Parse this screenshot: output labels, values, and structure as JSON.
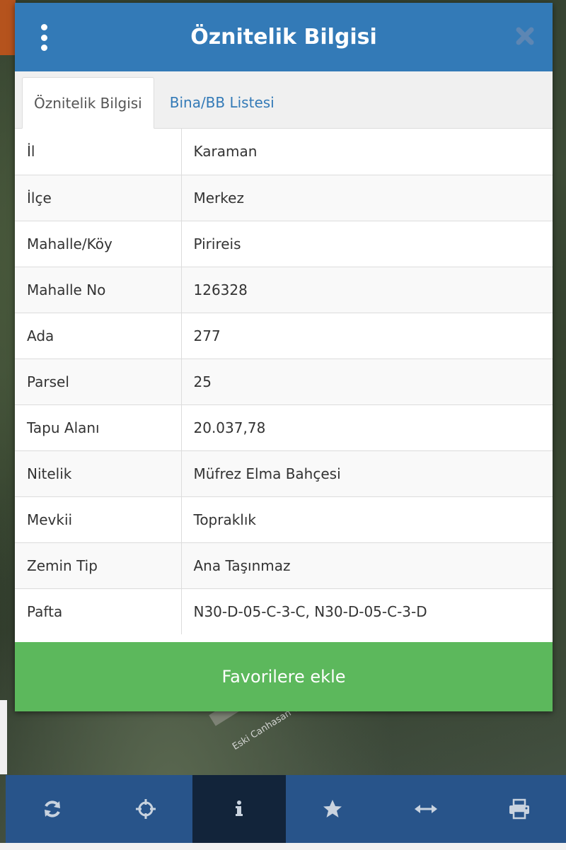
{
  "dialog": {
    "title": "Öznitelik Bilgisi",
    "menu_icon": "kebab-menu-icon",
    "close_icon": "close-icon"
  },
  "tabs": [
    {
      "label": "Öznitelik Bilgisi",
      "active": true
    },
    {
      "label": "Bina/BB Listesi",
      "active": false
    }
  ],
  "attributes": [
    {
      "key": "İl",
      "value": "Karaman"
    },
    {
      "key": "İlçe",
      "value": "Merkez"
    },
    {
      "key": "Mahalle/Köy",
      "value": "Pirireis"
    },
    {
      "key": "Mahalle No",
      "value": "126328"
    },
    {
      "key": "Ada",
      "value": "277"
    },
    {
      "key": "Parsel",
      "value": "25"
    },
    {
      "key": "Tapu Alanı",
      "value": "20.037,78"
    },
    {
      "key": "Nitelik",
      "value": "Müfrez Elma Bahçesi"
    },
    {
      "key": "Mevkii",
      "value": "Topraklık"
    },
    {
      "key": "Zemin Tip",
      "value": "Ana Taşınmaz"
    },
    {
      "key": "Pafta",
      "value": "N30-D-05-C-3-C, N30-D-05-C-3-D"
    }
  ],
  "actions": {
    "favorite_label": "Favorilere ekle"
  },
  "map": {
    "street_label": "Eski Canhasan Yo"
  },
  "toolbar": {
    "items": [
      {
        "icon": "refresh-icon",
        "active": false
      },
      {
        "icon": "locate-crosshair-icon",
        "active": false
      },
      {
        "icon": "info-icon",
        "active": true
      },
      {
        "icon": "star-icon",
        "active": false
      },
      {
        "icon": "measure-arrows-icon",
        "active": false
      },
      {
        "icon": "print-icon",
        "active": false
      }
    ]
  },
  "colors": {
    "header": "#337ab7",
    "button_green": "#5cb85c",
    "toolbar": "#28548a",
    "toolbar_active": "#12243a"
  }
}
